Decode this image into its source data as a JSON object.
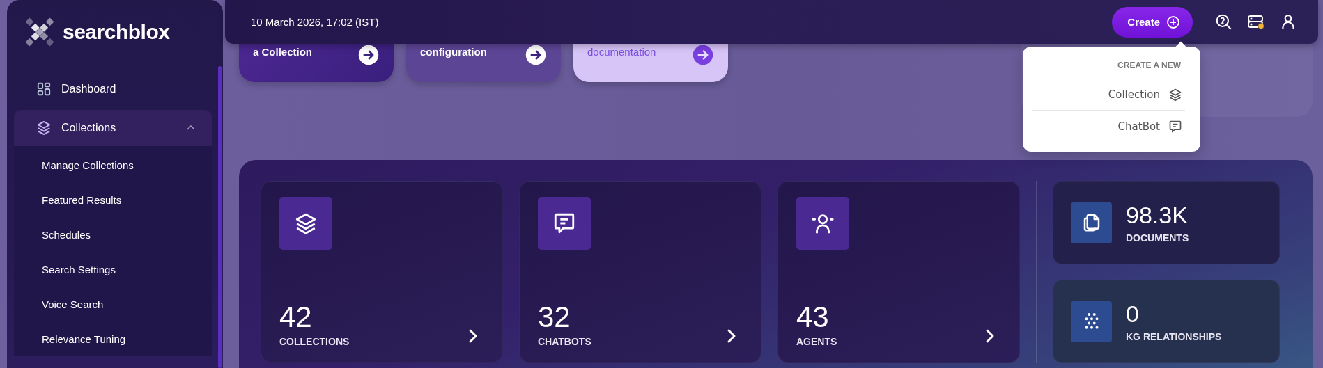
{
  "sidebar": {
    "logo": "searchblox",
    "items": [
      {
        "label": "Dashboard",
        "selected": false
      },
      {
        "label": "Collections",
        "selected": true,
        "expanded": true,
        "children": [
          {
            "label": "Manage Collections"
          },
          {
            "label": "Featured Results"
          },
          {
            "label": "Schedules"
          },
          {
            "label": "Search Settings"
          },
          {
            "label": "Voice Search"
          },
          {
            "label": "Relevance Tuning"
          }
        ]
      }
    ]
  },
  "topbar": {
    "datetime": "10 March 2026, 17:02 (IST)",
    "create_button": "Create"
  },
  "quick_actions": [
    {
      "label": "a Collection",
      "kind": "dark"
    },
    {
      "label": "configuration",
      "kind": "medium"
    },
    {
      "label": "documentation",
      "kind": "light"
    }
  ],
  "create_menu": {
    "heading": "CREATE A NEW",
    "items": [
      {
        "label": "Collection"
      },
      {
        "label": "ChatBot"
      }
    ]
  },
  "stats": [
    {
      "value": "42",
      "label": "COLLECTIONS"
    },
    {
      "value": "32",
      "label": "CHATBOTS"
    },
    {
      "value": "43",
      "label": "AGENTS"
    }
  ],
  "totals": [
    {
      "value": "98.3K",
      "label": "DOCUMENTS"
    },
    {
      "value": "0",
      "label": "KG RELATIONSHIPS"
    }
  ]
}
